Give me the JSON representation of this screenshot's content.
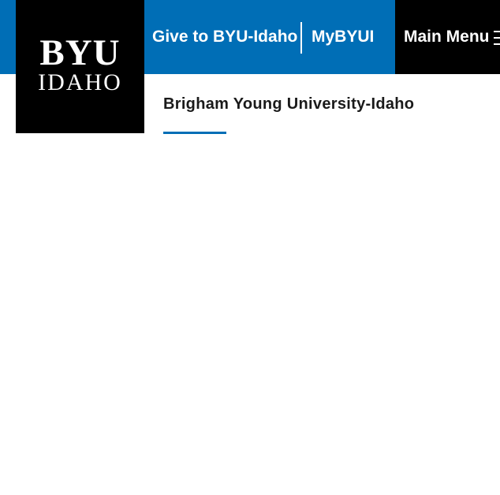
{
  "header": {
    "logo": {
      "line1": "BYU",
      "line2": "IDAHO"
    },
    "links": {
      "give": "Give to BYU-Idaho",
      "mybyui": "MyBYUI"
    },
    "menu": {
      "label": "Main Menu",
      "icon": "hamburger-icon"
    }
  },
  "main": {
    "site_title": "Brigham Young University-Idaho"
  },
  "colors": {
    "brand_blue": "#006eb6",
    "logo_black": "#000000"
  }
}
